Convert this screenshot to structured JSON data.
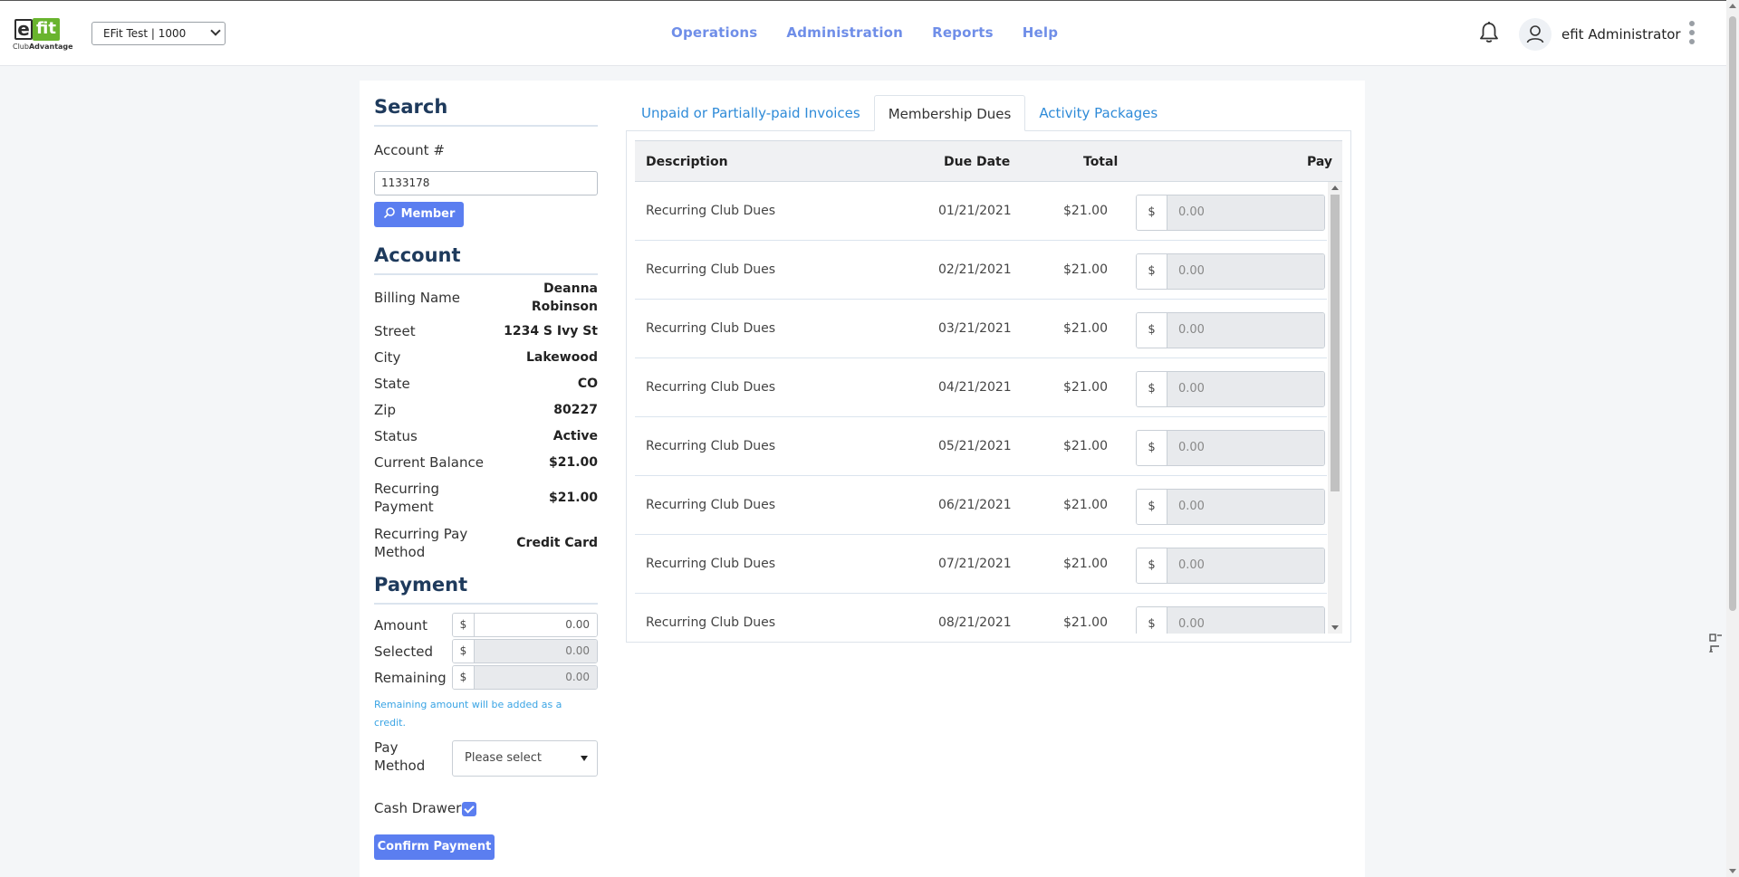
{
  "header": {
    "logo_text_e": "e",
    "logo_text_fit": "fit",
    "logo_sub_club": "Club",
    "logo_sub_advantage": "Advantage",
    "club_selector": "EFit Test | 1000",
    "nav": [
      "Operations",
      "Administration",
      "Reports",
      "Help"
    ],
    "user_name": "efit Administrator"
  },
  "search": {
    "title": "Search",
    "account_label": "Account #",
    "account_value": "1133178",
    "member_button": "Member"
  },
  "account": {
    "title": "Account",
    "fields": [
      {
        "label": "Billing Name",
        "value": "Deanna Robinson"
      },
      {
        "label": "Street",
        "value": "1234 S Ivy St"
      },
      {
        "label": "City",
        "value": "Lakewood"
      },
      {
        "label": "State",
        "value": "CO"
      },
      {
        "label": "Zip",
        "value": "80227"
      },
      {
        "label": "Status",
        "value": "Active"
      },
      {
        "label": "Current Balance",
        "value": "$21.00"
      },
      {
        "label": "Recurring Payment",
        "value": "$21.00"
      },
      {
        "label": "Recurring Pay Method",
        "value": "Credit Card"
      }
    ]
  },
  "payment": {
    "title": "Payment",
    "amount_label": "Amount",
    "amount_value": "0.00",
    "selected_label": "Selected",
    "selected_value": "0.00",
    "remaining_label": "Remaining",
    "remaining_value": "0.00",
    "currency": "$",
    "hint": "Remaining amount will be added as a credit.",
    "pay_method_label": "Pay Method",
    "pay_method_value": "Please select",
    "cash_drawer_label": "Cash Drawer",
    "cash_drawer_checked": true,
    "confirm_button": "Confirm Payment"
  },
  "tabs": [
    "Unpaid or Partially-paid Invoices",
    "Membership Dues",
    "Activity Packages"
  ],
  "active_tab": "Membership Dues",
  "dues_table": {
    "columns": [
      "Description",
      "Due Date",
      "Total",
      "Pay"
    ],
    "currency": "$",
    "rows": [
      {
        "description": "Recurring Club Dues",
        "due_date": "01/21/2021",
        "total": "$21.00",
        "pay": "0.00"
      },
      {
        "description": "Recurring Club Dues",
        "due_date": "02/21/2021",
        "total": "$21.00",
        "pay": "0.00"
      },
      {
        "description": "Recurring Club Dues",
        "due_date": "03/21/2021",
        "total": "$21.00",
        "pay": "0.00"
      },
      {
        "description": "Recurring Club Dues",
        "due_date": "04/21/2021",
        "total": "$21.00",
        "pay": "0.00"
      },
      {
        "description": "Recurring Club Dues",
        "due_date": "05/21/2021",
        "total": "$21.00",
        "pay": "0.00"
      },
      {
        "description": "Recurring Club Dues",
        "due_date": "06/21/2021",
        "total": "$21.00",
        "pay": "0.00"
      },
      {
        "description": "Recurring Club Dues",
        "due_date": "07/21/2021",
        "total": "$21.00",
        "pay": "0.00"
      },
      {
        "description": "Recurring Club Dues",
        "due_date": "08/21/2021",
        "total": "$21.00",
        "pay": "0.00"
      }
    ]
  },
  "colors": {
    "accent": "#5b7ef0",
    "nav": "#6f8ee8",
    "heading": "#1e3a5c",
    "link": "#2f8bd8",
    "hint": "#3aa4e4",
    "logo_green": "#69b42e"
  }
}
